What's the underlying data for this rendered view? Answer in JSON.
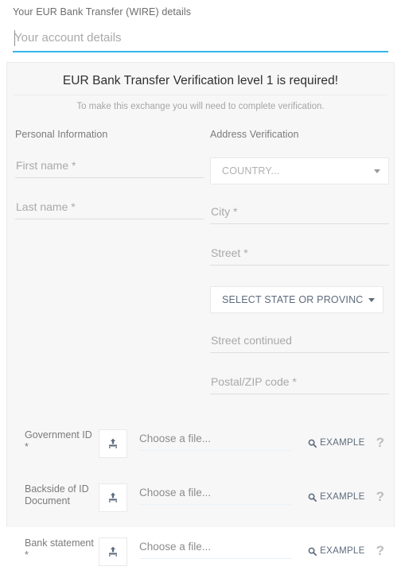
{
  "top": {
    "label": "Your EUR Bank Transfer (WIRE) details",
    "account_input_value": "",
    "account_input_placeholder": "Your account details",
    "accent_color": "#35b7ea"
  },
  "panel": {
    "title": "EUR Bank Transfer Verification level 1 is required!",
    "subtitle": "To make this exchange you will need to complete verification.",
    "background_color": "#f7f7f7"
  },
  "personal": {
    "heading": "Personal Information",
    "fields": [
      {
        "name": "first-name",
        "value": "",
        "placeholder": "First name *"
      },
      {
        "name": "last-name",
        "value": "",
        "placeholder": "Last name *"
      }
    ]
  },
  "address": {
    "heading": "Address Verification",
    "country_select": {
      "value": "COUNTRY...",
      "icon": "chevron-down-icon"
    },
    "city": {
      "value": "",
      "placeholder": "City *"
    },
    "street": {
      "value": "",
      "placeholder": "Street *"
    },
    "state_select": {
      "value": "SELECT STATE OR PROVINCE...",
      "icon": "chevron-down-icon",
      "text_color": "#5d6b7d"
    },
    "street_continued": {
      "value": "",
      "placeholder": "Street continued"
    },
    "postal": {
      "value": "",
      "placeholder": "Postal/ZIP code *"
    }
  },
  "uploads": {
    "example_label": "EXAMPLE",
    "example_icon": "search-icon",
    "help_icon": "question-mark-icon",
    "upload_icon": "upload-icon",
    "rows": [
      {
        "label": "Government ID *",
        "file_text": "Choose a file..."
      },
      {
        "label": "Backside of ID Document",
        "file_text": "Choose a file..."
      },
      {
        "label": "Bank statement *",
        "file_text": "Choose a file..."
      }
    ]
  }
}
